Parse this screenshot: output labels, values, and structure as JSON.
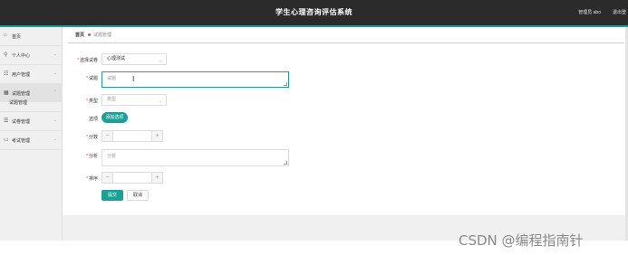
{
  "header": {
    "title": "学生心理咨询评估系统",
    "user": "管理员 abo",
    "logout": "退出登"
  },
  "sidebar": {
    "items": [
      {
        "icon": "home-icon",
        "label": "首页"
      },
      {
        "icon": "user-icon",
        "label": "个人中心"
      },
      {
        "icon": "users-icon",
        "label": "用户管理"
      },
      {
        "icon": "grid-icon",
        "label": "试题管理"
      },
      {
        "icon": "list-icon",
        "label": "试卷管理"
      },
      {
        "icon": "card-icon",
        "label": "考试管理"
      }
    ],
    "sub_item": "试题管理"
  },
  "breadcrumb": {
    "home": "首页",
    "current": "试题管理"
  },
  "form": {
    "exam_label": "选择试卷",
    "exam_value": "心理测试",
    "question_label": "试题",
    "question_placeholder": "试题",
    "type_label": "类型",
    "type_placeholder": "类型",
    "options_label": "选项",
    "add_option_button": "添加选项",
    "score_label": "分数",
    "analysis_label": "分析",
    "analysis_placeholder": "分析",
    "order_label": "排序",
    "submit_button": "提交",
    "cancel_button": "取消"
  },
  "watermark": "CSDN @编程指南针",
  "colors": {
    "accent": "#1aa094",
    "topbar": "#2b2b2b",
    "required": "#e74c3c"
  }
}
